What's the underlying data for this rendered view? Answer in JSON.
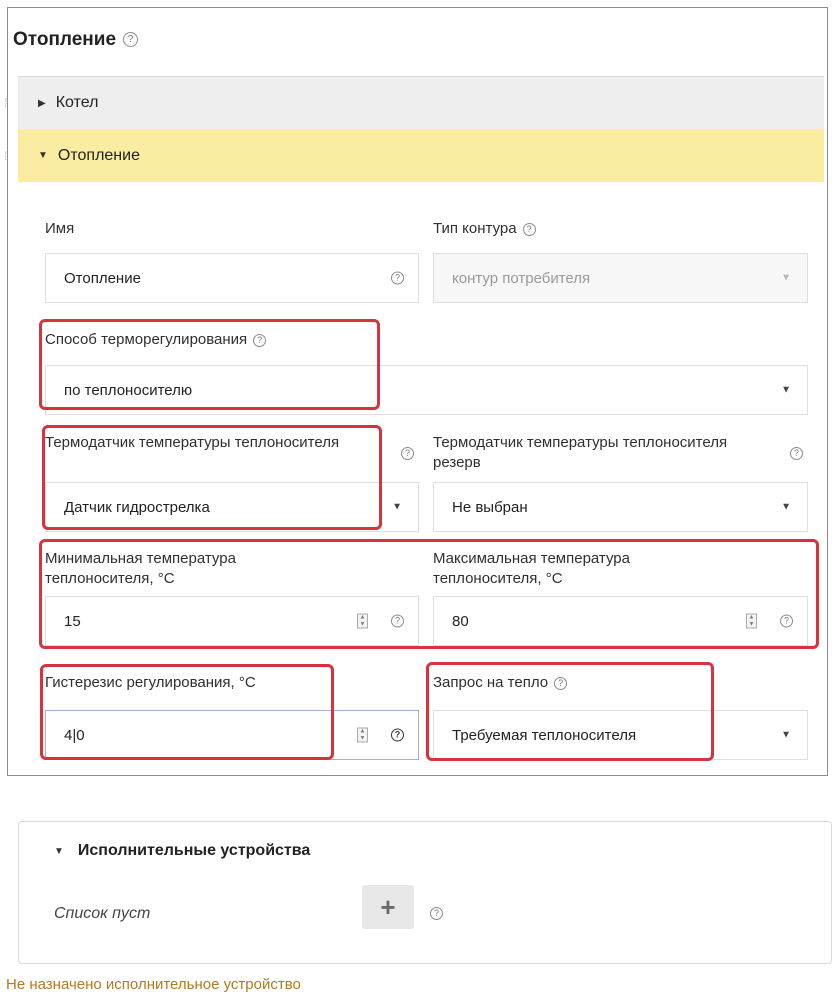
{
  "page": {
    "title": "Отопление"
  },
  "accordion": [
    {
      "label": "Котел",
      "expanded": false
    },
    {
      "label": "Отопление",
      "expanded": true
    }
  ],
  "form": {
    "name": {
      "label": "Имя",
      "value": "Отопление"
    },
    "circuit_type": {
      "label": "Тип контура",
      "value": "контур потребителя"
    },
    "regulation_method": {
      "label": "Способ терморегулирования",
      "value": "по теплоносителю"
    },
    "coolant_sensor": {
      "label": "Термодатчик температуры теплоносителя",
      "value": "Датчик гидрострелка"
    },
    "coolant_sensor_reserve": {
      "label": "Термодатчик температуры теплоносителя резерв",
      "value": "Не выбран"
    },
    "min_temp": {
      "label": "Минимальная температура теплоносителя, °C",
      "value": "15"
    },
    "max_temp": {
      "label": "Максимальная температура теплоносителя, °C",
      "value": "80"
    },
    "hysteresis": {
      "label": "Гистерезис регулирования, °C",
      "value": "4|0"
    },
    "heat_request": {
      "label": "Запрос на тепло",
      "value": "Требуемая теплоносителя"
    }
  },
  "devices": {
    "title": "Исполнительные устройства",
    "empty_text": "Список пуст",
    "add_label": "+",
    "warning": "Не назначено исполнительное устройство"
  },
  "icons": {
    "help": "?",
    "caret_down": "▼",
    "caret_right": "▶",
    "drag": "⁞"
  },
  "colors": {
    "highlight": "#d8333b",
    "active_section": "#faeca0",
    "warning": "#b07a1e"
  }
}
